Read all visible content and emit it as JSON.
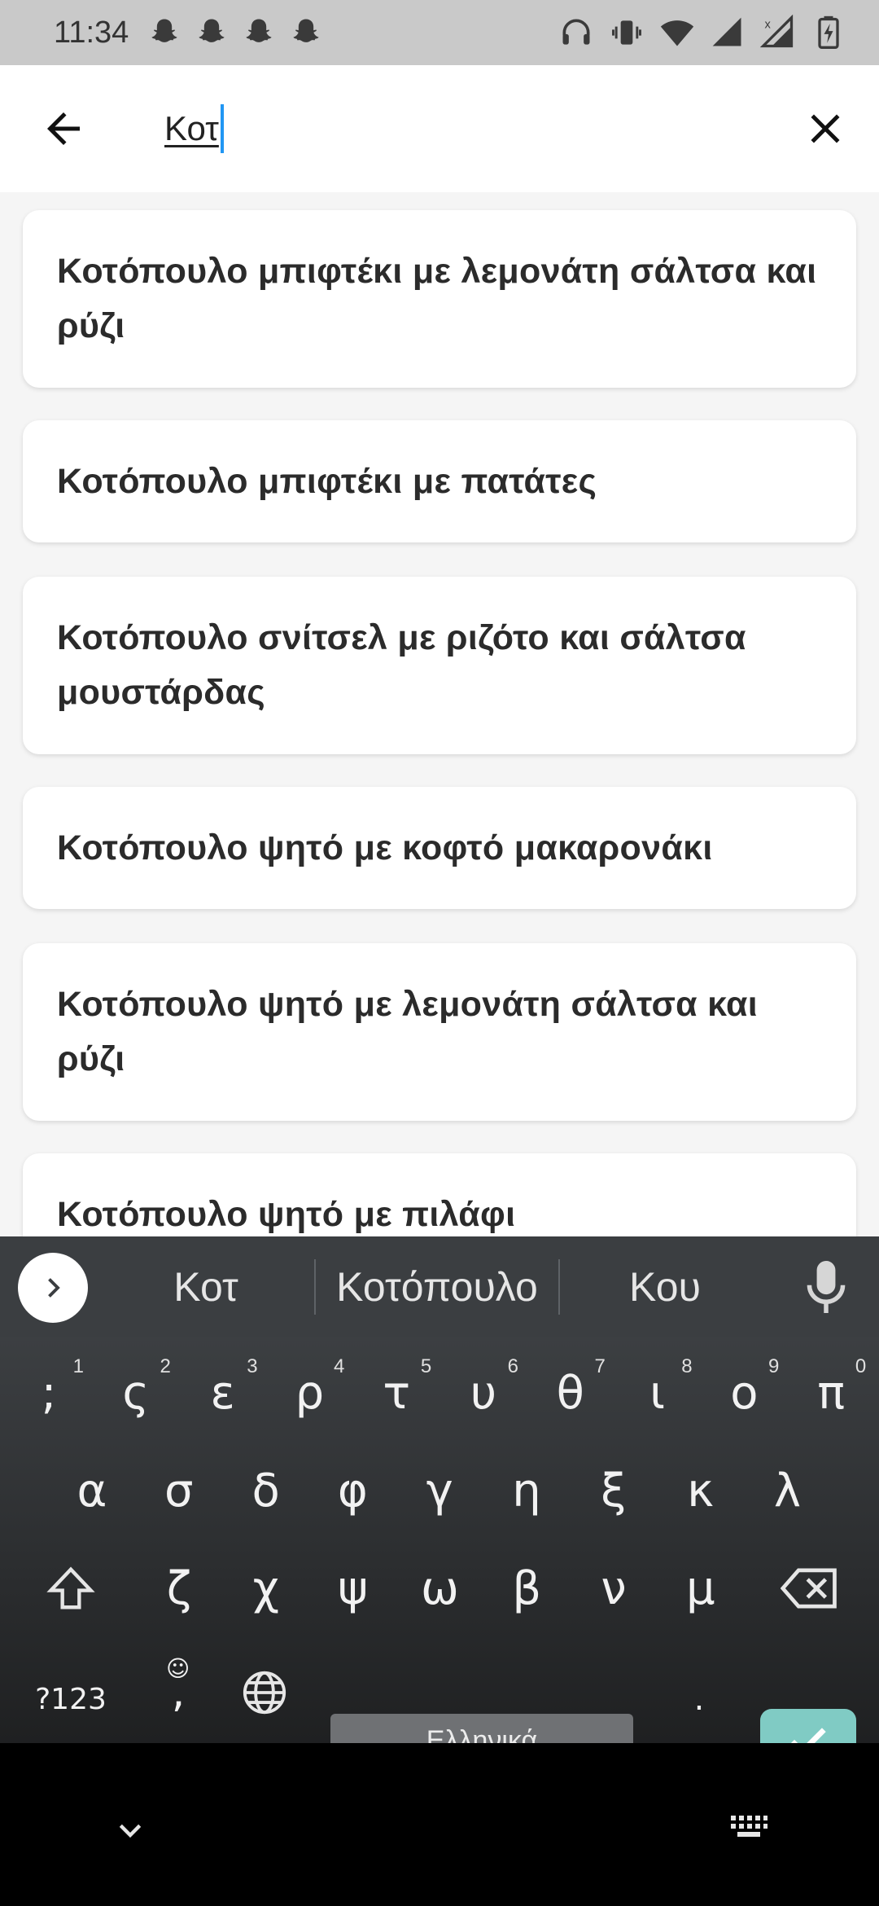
{
  "status_bar": {
    "time": "11:34",
    "notification_icons": [
      "snapchat-icon",
      "snapchat-icon",
      "snapchat-icon",
      "snapchat-icon"
    ],
    "right_icons": [
      "headphones-icon",
      "vibrate-icon",
      "wifi-icon",
      "signal-icon",
      "signal-no-data-icon",
      "battery-charging-icon"
    ]
  },
  "search": {
    "query": "Κοτ",
    "back_icon": "arrow-back-icon",
    "clear_icon": "close-icon"
  },
  "results": [
    {
      "label": "Κοτόπουλο μπιφτέκι με λεμονάτη σάλτσα και ρύζι"
    },
    {
      "label": "Κοτόπουλο μπιφτέκι με πατάτες"
    },
    {
      "label": "Κοτόπουλο σνίτσελ με ριζότο και σάλτσα μουστάρδας"
    },
    {
      "label": "Κοτόπουλο ψητό με κοφτό μακαρονάκι"
    },
    {
      "label": "Κοτόπουλο ψητό με λεμονάτη σάλτσα και ρύζι"
    },
    {
      "label": "Κοτόπουλο ψητό με πιλάφι"
    }
  ],
  "keyboard": {
    "suggestions": [
      "Κοτ",
      "Κοτόπουλο",
      "Κου"
    ],
    "row1": [
      {
        "k": ";",
        "h": "1"
      },
      {
        "k": "ς",
        "h": "2"
      },
      {
        "k": "ε",
        "h": "3"
      },
      {
        "k": "ρ",
        "h": "4"
      },
      {
        "k": "τ",
        "h": "5"
      },
      {
        "k": "υ",
        "h": "6"
      },
      {
        "k": "θ",
        "h": "7"
      },
      {
        "k": "ι",
        "h": "8"
      },
      {
        "k": "ο",
        "h": "9"
      },
      {
        "k": "π",
        "h": "0"
      }
    ],
    "row2": [
      "α",
      "σ",
      "δ",
      "φ",
      "γ",
      "η",
      "ξ",
      "κ",
      "λ"
    ],
    "row3": [
      "ζ",
      "χ",
      "ψ",
      "ω",
      "β",
      "ν",
      "μ"
    ],
    "symbols_label": "?123",
    "emoji_comma": ",",
    "space_label": "Ελληνικά",
    "period": ".",
    "accent_color": "#80cbc4"
  }
}
